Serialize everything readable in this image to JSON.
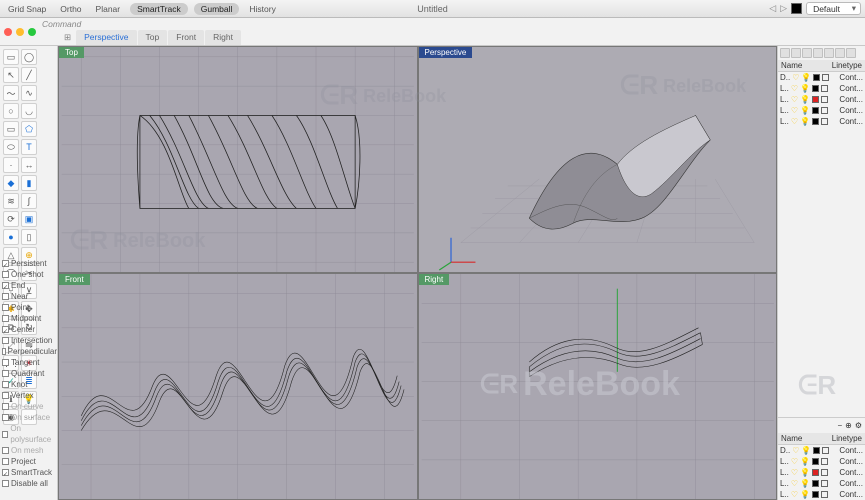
{
  "title": "Untitled",
  "topbar": {
    "toggles": [
      "Grid Snap",
      "Ortho",
      "Planar",
      "SmartTrack",
      "Gumball",
      "History"
    ],
    "active_toggles": [
      "SmartTrack",
      "Gumball"
    ],
    "layer_dropdown": "Default"
  },
  "command": {
    "label": "Command"
  },
  "view_tabs": [
    "Perspective",
    "Top",
    "Front",
    "Right"
  ],
  "active_tab": "Perspective",
  "viewports": {
    "top": "Top",
    "perspective": "Perspective",
    "front": "Front",
    "right": "Right"
  },
  "osnap": {
    "items": [
      {
        "label": "Persistent",
        "on": true
      },
      {
        "label": "One shot",
        "on": false
      },
      {
        "label": "End",
        "on": true
      },
      {
        "label": "Near",
        "on": false
      },
      {
        "label": "Point",
        "on": false
      },
      {
        "label": "Midpoint",
        "on": false
      },
      {
        "label": "Center",
        "on": true
      },
      {
        "label": "Intersection",
        "on": false
      },
      {
        "label": "Perpendicular",
        "on": false
      },
      {
        "label": "Tangent",
        "on": false
      },
      {
        "label": "Quadrant",
        "on": false
      },
      {
        "label": "Knot",
        "on": false
      },
      {
        "label": "Vertex",
        "on": false
      },
      {
        "label": "On curve",
        "on": false,
        "dim": true
      },
      {
        "label": "On surface",
        "on": false,
        "dim": true
      },
      {
        "label": "On polysurface",
        "on": false,
        "dim": true
      },
      {
        "label": "On mesh",
        "on": false,
        "dim": true
      },
      {
        "label": "Project",
        "on": false
      },
      {
        "label": "SmartTrack",
        "on": true
      },
      {
        "label": "Disable all",
        "on": false
      }
    ]
  },
  "layers_panel": {
    "header": {
      "name": "Name",
      "linetype": "Linetype"
    },
    "rows": [
      {
        "name": "D..",
        "color": "#000",
        "lt": "Cont..."
      },
      {
        "name": "L..",
        "color": "#000",
        "lt": "Cont..."
      },
      {
        "name": "L..",
        "color": "#d22",
        "lt": "Cont..."
      },
      {
        "name": "L..",
        "color": "#000",
        "lt": "Cont..."
      },
      {
        "name": "L..",
        "color": "#000",
        "lt": "Cont..."
      }
    ],
    "rows2": [
      {
        "name": "D..",
        "color": "#000",
        "lt": "Cont..."
      },
      {
        "name": "L..",
        "color": "#000",
        "lt": "Cont..."
      },
      {
        "name": "L..",
        "color": "#d22",
        "lt": "Cont..."
      },
      {
        "name": "L..",
        "color": "#000",
        "lt": "Cont..."
      },
      {
        "name": "L..",
        "color": "#000",
        "lt": "Cont..."
      }
    ]
  },
  "watermark": "ReleBook"
}
